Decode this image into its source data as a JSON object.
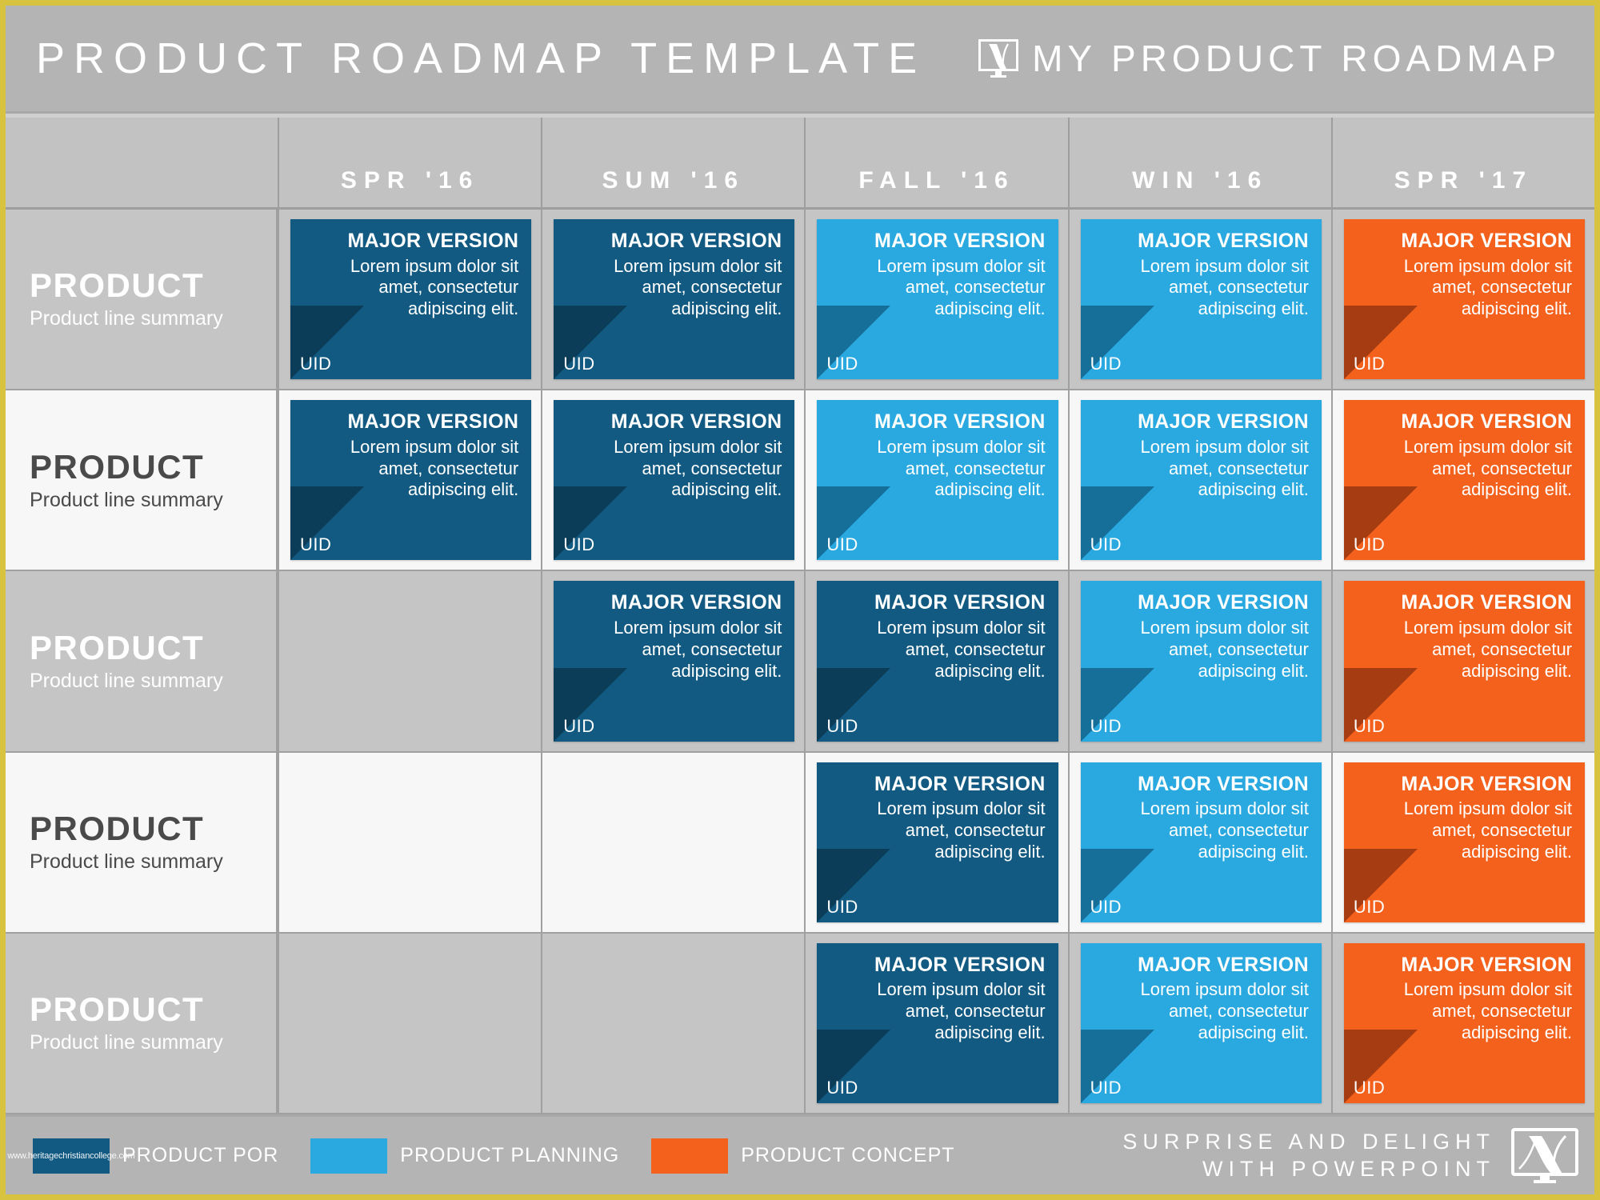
{
  "header": {
    "title": "PRODUCT ROADMAP TEMPLATE",
    "brand": "MY PRODUCT ROADMAP",
    "logo_icon": "monitor-road-icon"
  },
  "columns": [
    {
      "label": "SPR '16"
    },
    {
      "label": "SUM '16"
    },
    {
      "label": "FALL '16"
    },
    {
      "label": "WIN '16"
    },
    {
      "label": "SPR '17"
    }
  ],
  "card_defaults": {
    "title": "MAJOR VERSION",
    "body": "Lorem ipsum dolor sit amet, consectetur adipiscing elit.",
    "uid": "UID"
  },
  "colors": {
    "por": "#125a82",
    "planning": "#2aa9e0",
    "concept": "#f4611c",
    "por_shadow": "#0b3c58",
    "planning_shadow": "#156f99",
    "concept_shadow": "#a53c12",
    "border_gold": "#d8c341",
    "header_gray": "#b4b4b4",
    "row_dark": "#c5c5c5",
    "row_light": "#f7f7f7"
  },
  "rows": [
    {
      "title": "PRODUCT",
      "subtitle": "Product line summary",
      "shade": "dark",
      "cards": [
        {
          "kind": "por",
          "title": "MAJOR VERSION",
          "body": "Lorem ipsum dolor sit amet, consectetur adipiscing elit.",
          "uid": "UID"
        },
        {
          "kind": "por",
          "title": "MAJOR VERSION",
          "body": "Lorem ipsum dolor sit amet, consectetur adipiscing elit.",
          "uid": "UID"
        },
        {
          "kind": "planning",
          "title": "MAJOR VERSION",
          "body": "Lorem ipsum dolor sit amet, consectetur adipiscing elit.",
          "uid": "UID"
        },
        {
          "kind": "planning",
          "title": "MAJOR VERSION",
          "body": "Lorem ipsum dolor sit amet, consectetur adipiscing elit.",
          "uid": "UID"
        },
        {
          "kind": "concept",
          "title": "MAJOR VERSION",
          "body": "Lorem ipsum dolor sit amet, consectetur adipiscing elit.",
          "uid": "UID"
        }
      ]
    },
    {
      "title": "PRODUCT",
      "subtitle": "Product line summary",
      "shade": "light",
      "cards": [
        {
          "kind": "por",
          "title": "MAJOR VERSION",
          "body": "Lorem ipsum dolor sit amet, consectetur adipiscing elit.",
          "uid": "UID"
        },
        {
          "kind": "por",
          "title": "MAJOR VERSION",
          "body": "Lorem ipsum dolor sit amet, consectetur adipiscing elit.",
          "uid": "UID"
        },
        {
          "kind": "planning",
          "title": "MAJOR VERSION",
          "body": "Lorem ipsum dolor sit amet, consectetur adipiscing elit.",
          "uid": "UID"
        },
        {
          "kind": "planning",
          "title": "MAJOR VERSION",
          "body": "Lorem ipsum dolor sit amet, consectetur adipiscing elit.",
          "uid": "UID"
        },
        {
          "kind": "concept",
          "title": "MAJOR VERSION",
          "body": "Lorem ipsum dolor sit amet, consectetur adipiscing elit.",
          "uid": "UID"
        }
      ]
    },
    {
      "title": "PRODUCT",
      "subtitle": "Product line summary",
      "shade": "dark",
      "cards": [
        null,
        {
          "kind": "por",
          "title": "MAJOR VERSION",
          "body": "Lorem ipsum dolor sit amet, consectetur adipiscing elit.",
          "uid": "UID"
        },
        {
          "kind": "por",
          "title": "MAJOR VERSION",
          "body": "Lorem ipsum dolor sit amet, consectetur adipiscing elit.",
          "uid": "UID"
        },
        {
          "kind": "planning",
          "title": "MAJOR VERSION",
          "body": "Lorem ipsum dolor sit amet, consectetur adipiscing elit.",
          "uid": "UID"
        },
        {
          "kind": "concept",
          "title": "MAJOR VERSION",
          "body": "Lorem ipsum dolor sit amet, consectetur adipiscing elit.",
          "uid": "UID"
        }
      ]
    },
    {
      "title": "PRODUCT",
      "subtitle": "Product line summary",
      "shade": "light",
      "cards": [
        null,
        null,
        {
          "kind": "por",
          "title": "MAJOR VERSION",
          "body": "Lorem ipsum dolor sit amet, consectetur adipiscing elit.",
          "uid": "UID"
        },
        {
          "kind": "planning",
          "title": "MAJOR VERSION",
          "body": "Lorem ipsum dolor sit amet, consectetur adipiscing elit.",
          "uid": "UID"
        },
        {
          "kind": "concept",
          "title": "MAJOR VERSION",
          "body": "Lorem ipsum dolor sit amet, consectetur adipiscing elit.",
          "uid": "UID"
        }
      ]
    },
    {
      "title": "PRODUCT",
      "subtitle": "Product line summary",
      "shade": "dark",
      "cards": [
        null,
        null,
        {
          "kind": "por",
          "title": "MAJOR VERSION",
          "body": "Lorem ipsum dolor sit amet, consectetur adipiscing elit.",
          "uid": "UID"
        },
        {
          "kind": "planning",
          "title": "MAJOR VERSION",
          "body": "Lorem ipsum dolor sit amet, consectetur adipiscing elit.",
          "uid": "UID"
        },
        {
          "kind": "concept",
          "title": "MAJOR VERSION",
          "body": "Lorem ipsum dolor sit amet, consectetur adipiscing elit.",
          "uid": "UID"
        }
      ]
    }
  ],
  "footer": {
    "legend": [
      {
        "kind": "por",
        "label": "PRODUCT POR"
      },
      {
        "kind": "planning",
        "label": "PRODUCT PLANNING"
      },
      {
        "kind": "concept",
        "label": "PRODUCT CONCEPT"
      }
    ],
    "watermark": "www.heritagechristiancollege.com",
    "tagline_line1": "SURPRISE AND DELIGHT",
    "tagline_line2": "WITH POWERPOINT",
    "logo_icon": "monitor-road-icon"
  }
}
